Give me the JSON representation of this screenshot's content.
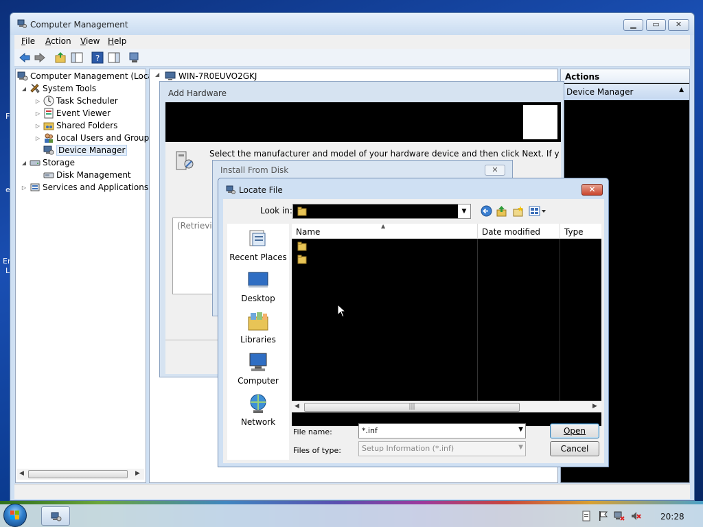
{
  "desktop": {
    "edge_letters": [
      "F",
      "e",
      "En",
      "L"
    ]
  },
  "main_window": {
    "title": "Computer Management",
    "menu": [
      {
        "accel": "F",
        "rest": "ile"
      },
      {
        "accel": "A",
        "rest": "ction"
      },
      {
        "accel": "V",
        "rest": "iew"
      },
      {
        "accel": "H",
        "rest": "elp"
      }
    ],
    "tree": {
      "root": "Computer Management (Local",
      "system_tools": "System Tools",
      "task_scheduler": "Task Scheduler",
      "event_viewer": "Event Viewer",
      "shared_folders": "Shared Folders",
      "local_users": "Local Users and Groups",
      "device_manager": "Device Manager",
      "storage": "Storage",
      "disk_management": "Disk Management",
      "services_apps": "Services and Applications"
    },
    "computer_name": "WIN-7R0EUVO2GKJ",
    "actions_header": "Actions",
    "actions_item": "Device Manager"
  },
  "add_hardware": {
    "title": "Add Hardware",
    "instruction": "Select the manufacturer and model of your hardware device and then click Next. If you have a",
    "retrieving": "(Retrieving"
  },
  "install_from_disk": {
    "title": "Install From Disk"
  },
  "locate_file": {
    "title": "Locate File",
    "look_in_label": "Look in:",
    "places": [
      "Recent Places",
      "Desktop",
      "Libraries",
      "Computer",
      "Network"
    ],
    "columns": [
      "Name",
      "Date modified",
      "Type"
    ],
    "file_name_label": "File name:",
    "file_name_value": "*.inf",
    "files_of_type_label": "Files of type:",
    "files_of_type_value": "Setup Information (*.inf)",
    "open_label": "Open",
    "cancel_label": "Cancel"
  },
  "taskbar": {
    "clock": "20:28"
  }
}
